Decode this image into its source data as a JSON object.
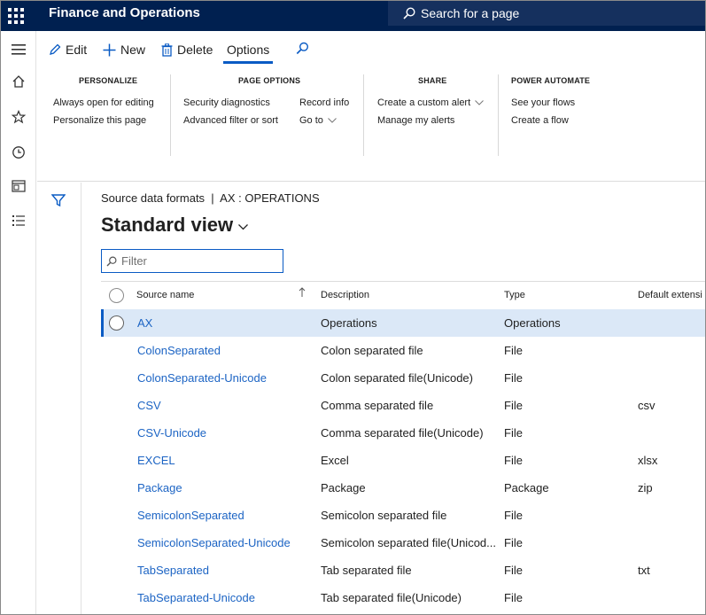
{
  "app": {
    "title": "Finance and Operations"
  },
  "search": {
    "label": "Search for a page"
  },
  "leftnav": {
    "icons": [
      "menu-icon",
      "home-icon",
      "star-icon",
      "clock-icon",
      "workspace-icon",
      "list-icon"
    ]
  },
  "actionpane": {
    "edit_label": "Edit",
    "new_label": "New",
    "delete_label": "Delete",
    "options_label": "Options",
    "groups": {
      "personalize": {
        "header": "PERSONALIZE",
        "items": [
          "Always open for editing",
          "Personalize this page"
        ]
      },
      "page_options": {
        "header": "PAGE OPTIONS",
        "items": [
          "Security diagnostics",
          "Advanced filter or sort",
          "Record info",
          "Go to"
        ]
      },
      "share": {
        "header": "SHARE",
        "items": [
          "Create a custom alert",
          "Manage my alerts"
        ]
      },
      "power_automate": {
        "header": "POWER AUTOMATE",
        "items": [
          "See your flows",
          "Create a flow"
        ]
      }
    }
  },
  "breadcrumb": "Source data formats  |  AX : OPERATIONS",
  "view": {
    "title": "Standard view"
  },
  "filter": {
    "placeholder": "Filter"
  },
  "grid": {
    "columns": [
      "Source name",
      "Description",
      "Type",
      "Default extensi"
    ],
    "rows": [
      {
        "name": "AX",
        "description": "Operations",
        "type": "Operations",
        "ext": ""
      },
      {
        "name": "ColonSeparated",
        "description": "Colon separated file",
        "type": "File",
        "ext": ""
      },
      {
        "name": "ColonSeparated-Unicode",
        "description": "Colon separated file(Unicode)",
        "type": "File",
        "ext": ""
      },
      {
        "name": "CSV",
        "description": "Comma separated file",
        "type": "File",
        "ext": "csv"
      },
      {
        "name": "CSV-Unicode",
        "description": "Comma separated file(Unicode)",
        "type": "File",
        "ext": ""
      },
      {
        "name": "EXCEL",
        "description": "Excel",
        "type": "File",
        "ext": "xlsx"
      },
      {
        "name": "Package",
        "description": "Package",
        "type": "Package",
        "ext": "zip"
      },
      {
        "name": "SemicolonSeparated",
        "description": "Semicolon separated file",
        "type": "File",
        "ext": ""
      },
      {
        "name": "SemicolonSeparated-Unicode",
        "description": "Semicolon separated file(Unicod...",
        "type": "File",
        "ext": ""
      },
      {
        "name": "TabSeparated",
        "description": "Tab separated file",
        "type": "File",
        "ext": "txt"
      },
      {
        "name": "TabSeparated-Unicode",
        "description": "Tab separated file(Unicode)",
        "type": "File",
        "ext": ""
      }
    ]
  },
  "colors": {
    "topbar": "#002050",
    "accent": "#0a5bc4",
    "link": "#1c64c4",
    "selected_row": "#dbe8f7"
  }
}
